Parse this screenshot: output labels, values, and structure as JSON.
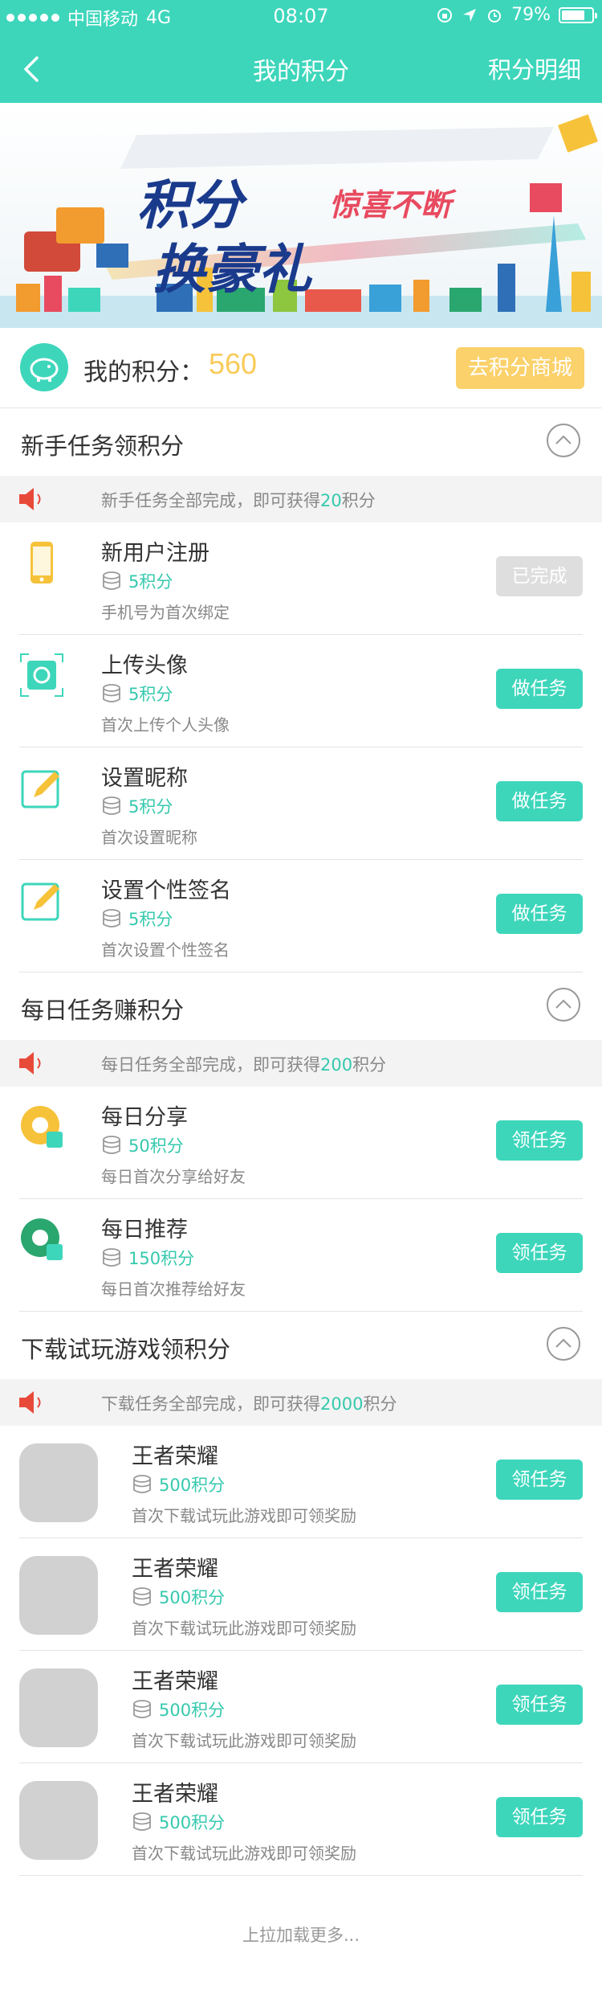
{
  "status_bar": {
    "carrier": "中国移动",
    "network": "4G",
    "time": "08:07",
    "battery": "79%",
    "battery_level": 0.79
  },
  "nav": {
    "title": "我的积分",
    "detail": "积分明细"
  },
  "banner": {
    "line1": "积分",
    "line2": "换豪礼",
    "tag": "惊喜不断"
  },
  "points": {
    "label": "我的积分：",
    "value": "560",
    "mall_button": "去积分商城"
  },
  "sections": {
    "newbie": {
      "title": "新手任务领积分",
      "notice_pre": "新手任务全部完成，即可获得",
      "notice_num": "20",
      "notice_post": "积分",
      "tasks": [
        {
          "name": "新用户注册",
          "points": "5积分",
          "desc": "手机号为首次绑定",
          "button": "已完成",
          "icon": "phone-icon"
        },
        {
          "name": "上传头像",
          "points": "5积分",
          "desc": "首次上传个人头像",
          "button": "做任务",
          "icon": "camera-upload-icon"
        },
        {
          "name": "设置昵称",
          "points": "5积分",
          "desc": "首次设置昵称",
          "button": "做任务",
          "icon": "pencil-edit-icon"
        },
        {
          "name": "设置个性签名",
          "points": "5积分",
          "desc": "首次设置个性签名",
          "button": "做任务",
          "icon": "pencil-edit-icon"
        }
      ]
    },
    "daily": {
      "title": "每日任务赚积分",
      "notice_pre": "每日任务全部完成，即可获得",
      "notice_num": "200",
      "notice_post": "积分",
      "tasks": [
        {
          "name": "每日分享",
          "points": "50积分",
          "desc": "每日首次分享给好友",
          "button": "领任务",
          "icon": "share-icon"
        },
        {
          "name": "每日推荐",
          "points": "150积分",
          "desc": "每日首次推荐给好友",
          "button": "领任务",
          "icon": "recommend-icon"
        }
      ]
    },
    "games": {
      "title": "下载试玩游戏领积分",
      "notice_pre": "下载任务全部完成，即可获得",
      "notice_num": "2000",
      "notice_post": "积分",
      "tasks": [
        {
          "name": "王者荣耀",
          "points": "500积分",
          "desc": "首次下载试玩此游戏即可领奖励",
          "button": "领任务"
        },
        {
          "name": "王者荣耀",
          "points": "500积分",
          "desc": "首次下载试玩此游戏即可领奖励",
          "button": "领任务"
        },
        {
          "name": "王者荣耀",
          "points": "500积分",
          "desc": "首次下载试玩此游戏即可领奖励",
          "button": "领任务"
        },
        {
          "name": "王者荣耀",
          "points": "500积分",
          "desc": "首次下载试玩此游戏即可领奖励",
          "button": "领任务"
        }
      ]
    }
  },
  "load_more": "上拉加载更多...",
  "colors": {
    "primary": "#3dd6bb",
    "accent_text": "#35c9ad",
    "points_value": "#f9cb5a",
    "mall_button": "#fbd16b",
    "done_button": "#dedede"
  }
}
